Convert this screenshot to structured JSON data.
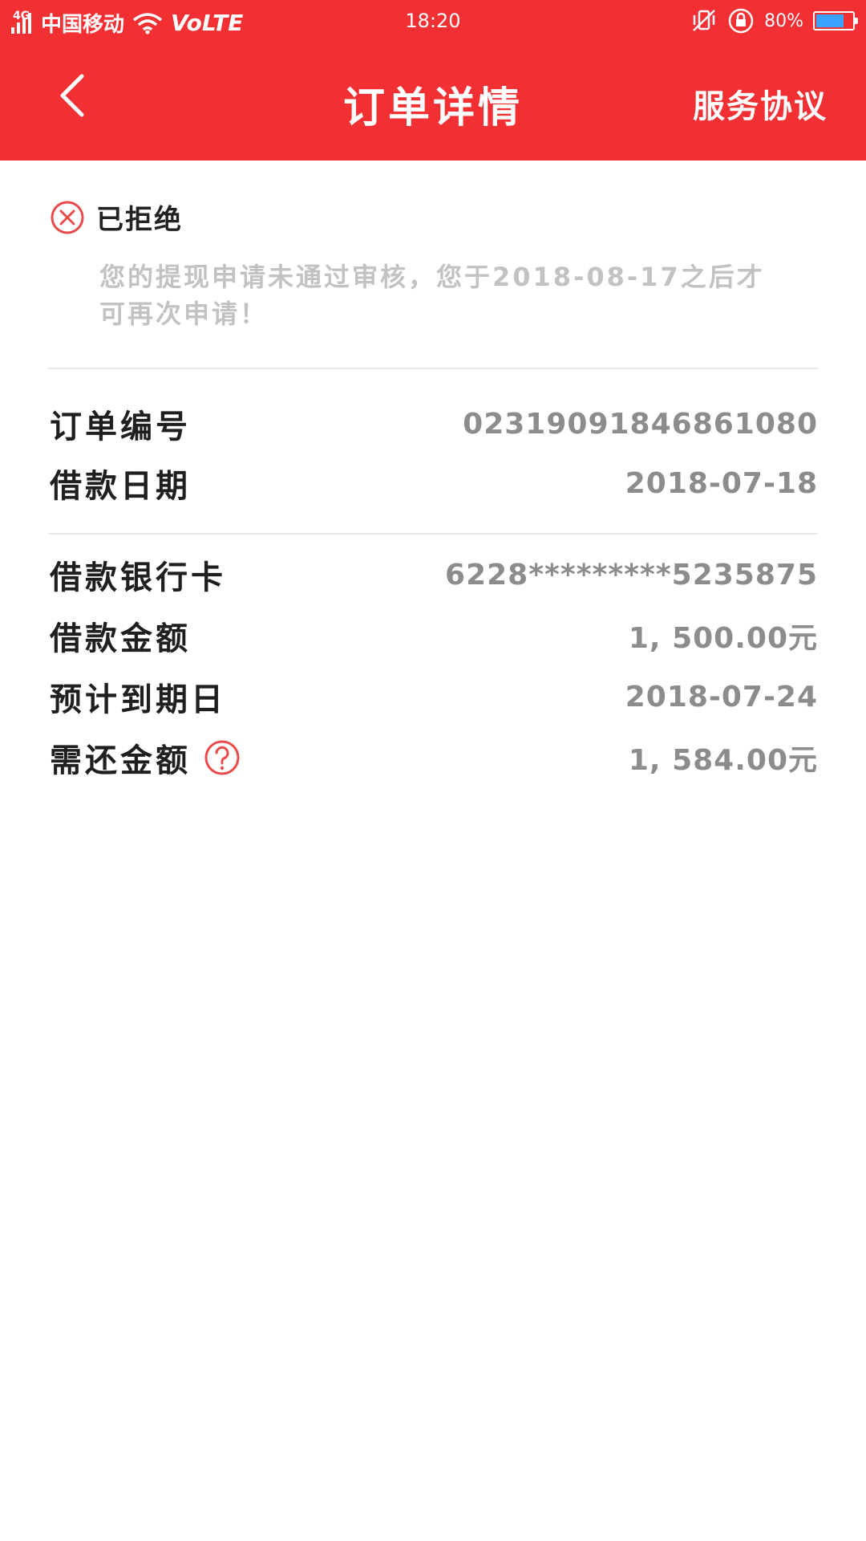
{
  "status_bar": {
    "network_gen": "4G",
    "carrier": "中国移动",
    "volte": "VoLTE",
    "time": "18:20",
    "battery_text": "80%",
    "battery_level": 0.8,
    "icons": [
      "signal-icon",
      "wifi-icon",
      "vibrate-icon",
      "rotation-lock-icon",
      "battery-icon"
    ]
  },
  "nav": {
    "title": "订单详情",
    "action": "服务协议",
    "back_icon": "chevron-left-icon"
  },
  "order_status": {
    "label": "已拒绝",
    "icon": "close-circle-icon",
    "notice": "您的提现申请未通过审核，您于2018-08-17之后才可再次申请！"
  },
  "section1": [
    {
      "label": "订单编号",
      "value": "02319091846861080"
    },
    {
      "label": "借款日期",
      "value": "2018-07-18"
    }
  ],
  "section2": [
    {
      "label": "借款银行卡",
      "value": "6228*********5235875"
    },
    {
      "label": "借款金额",
      "value": "1, 500.00元"
    },
    {
      "label": "预计到期日",
      "value": "2018-07-24"
    },
    {
      "label": "需还金额",
      "value": "1, 584.00元",
      "help_icon": "question-circle-icon"
    }
  ],
  "colors": {
    "brand_red": "#f23034",
    "label_text": "#1f1f1f",
    "value_text": "#8c8c8c",
    "notice_text": "#c2c2c2",
    "battery_fill": "#3aa3ff"
  }
}
